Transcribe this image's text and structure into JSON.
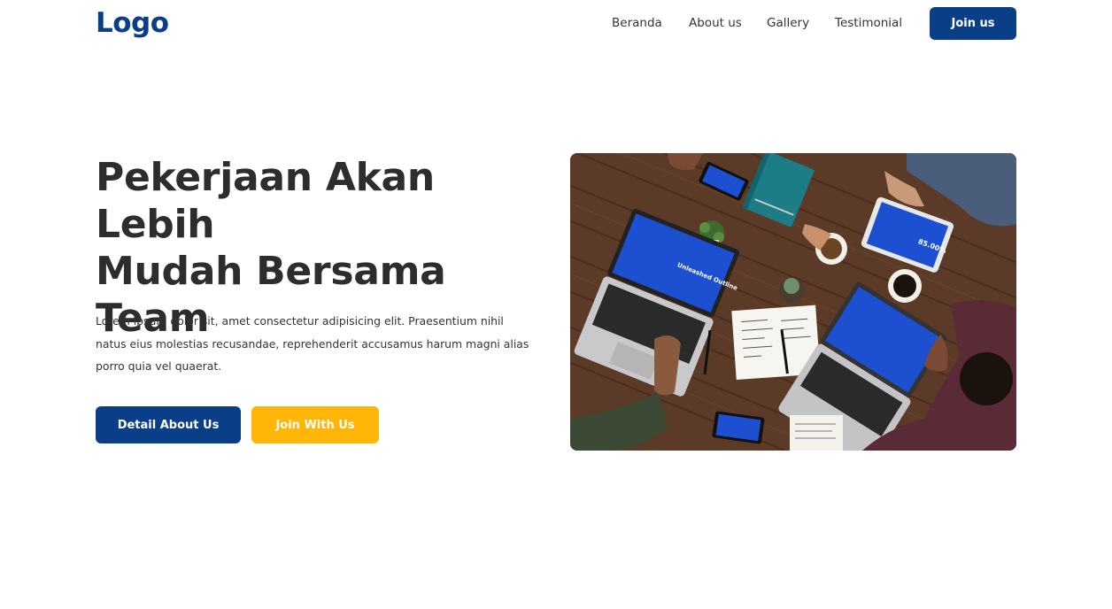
{
  "nav": {
    "logo": "Logo",
    "links": [
      "Beranda",
      "About us",
      "Gallery",
      "Testimonial"
    ],
    "cta": "Join us"
  },
  "hero": {
    "title_lines": [
      "Pekerjaan Akan Lebih",
      "Mudah Bersama",
      "Team"
    ],
    "description": "Lorem ipsum dolor sit, amet consectetur adipisicing elit. Praesentium nihil natus eius molestias recusandae, reprehenderit accusamus harum magni alias porro quia vel quaerat.",
    "primary_button": "Detail About Us",
    "secondary_button": "Join With Us",
    "image_screen_texts": [
      "Unleashed Outline",
      "85.00%",
      "85.00%"
    ]
  },
  "colors": {
    "brand": "#0a3f87",
    "accent": "#ffb606",
    "text": "#2d2d2d"
  }
}
